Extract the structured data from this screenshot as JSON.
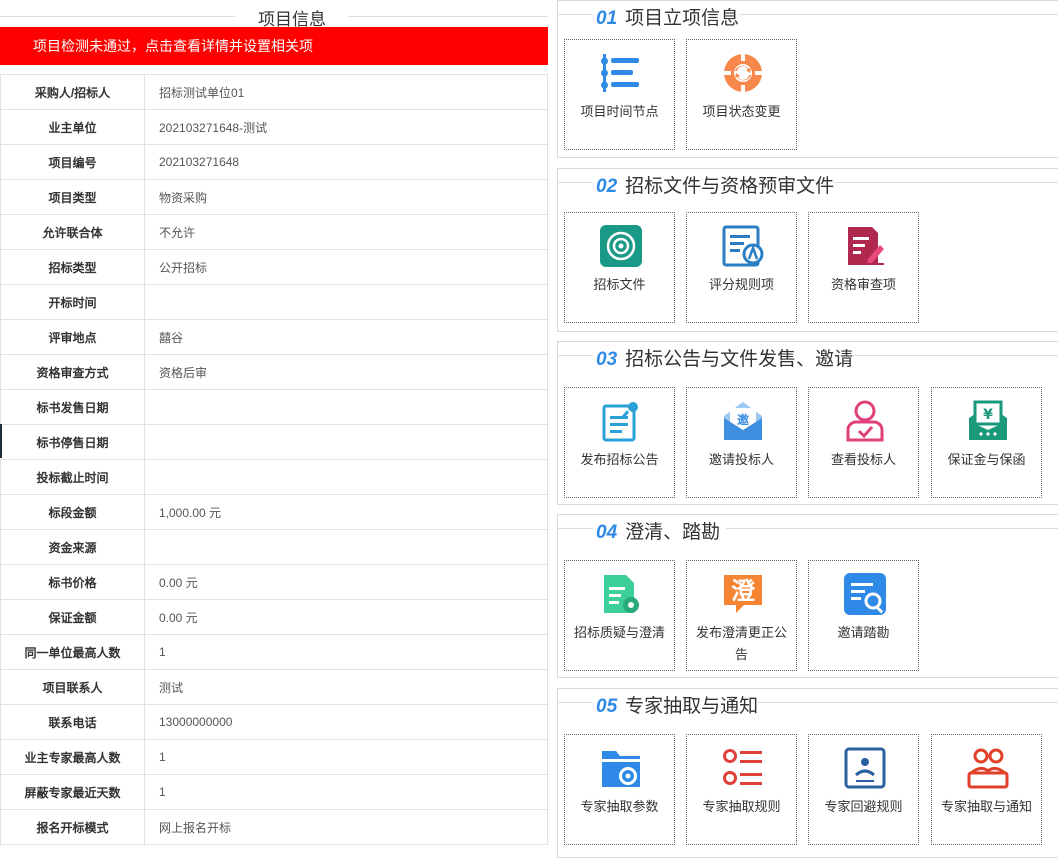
{
  "left": {
    "title": "项目信息",
    "alert": "项目检测未通过，点击查看详情并设置相关项",
    "rows": [
      {
        "label": "采购人/招标人",
        "value": "招标测试单位01"
      },
      {
        "label": "业主单位",
        "value": "202103271648-测试"
      },
      {
        "label": "项目编号",
        "value": "202103271648"
      },
      {
        "label": "项目类型",
        "value": "物资采购"
      },
      {
        "label": "允许联合体",
        "value": "不允许"
      },
      {
        "label": "招标类型",
        "value": "公开招标"
      },
      {
        "label": "开标时间",
        "value": ""
      },
      {
        "label": "评审地点",
        "value": "囍谷"
      },
      {
        "label": "资格审查方式",
        "value": "资格后审"
      },
      {
        "label": "标书发售日期",
        "value": ""
      },
      {
        "label": "标书停售日期",
        "value": ""
      },
      {
        "label": "投标截止时间",
        "value": ""
      },
      {
        "label": "标段金额",
        "value": "1,000.00 元"
      },
      {
        "label": "资金来源",
        "value": ""
      },
      {
        "label": "标书价格",
        "value": "0.00 元"
      },
      {
        "label": "保证金额",
        "value": "0.00 元"
      },
      {
        "label": "同一单位最高人数",
        "value": "1"
      },
      {
        "label": "项目联系人",
        "value": "测试"
      },
      {
        "label": "联系电话",
        "value": "13000000000"
      },
      {
        "label": "业主专家最高人数",
        "value": "1"
      },
      {
        "label": "屏蔽专家最近天数",
        "value": "1"
      },
      {
        "label": "报名开标模式",
        "value": "网上报名开标"
      }
    ]
  },
  "sections": [
    {
      "num": "01",
      "title": "项目立项信息",
      "tiles": [
        {
          "label": "项目时间节点",
          "icon": "timeline-icon",
          "color": "#2e8ae6"
        },
        {
          "label": "项目状态变更",
          "icon": "status-change-icon",
          "color": "#f7874a"
        }
      ]
    },
    {
      "num": "02",
      "title": "招标文件与资格预审文件",
      "tiles": [
        {
          "label": "招标文件",
          "icon": "target-document-icon",
          "color": "#1a9a86"
        },
        {
          "label": "评分规则项",
          "icon": "scoring-rules-icon",
          "color": "#2a7fc4"
        },
        {
          "label": "资格审查项",
          "icon": "qualification-review-icon",
          "color": "#b0284e"
        }
      ]
    },
    {
      "num": "03",
      "title": "招标公告与文件发售、邀请",
      "tiles": [
        {
          "label": "发布招标公告",
          "icon": "publish-notice-icon",
          "color": "#2aa0d8"
        },
        {
          "label": "邀请投标人",
          "icon": "invite-envelope-icon",
          "color": "#3f8fe0"
        },
        {
          "label": "查看投标人",
          "icon": "bidder-view-icon",
          "color": "#e0407a"
        },
        {
          "label": "保证金与保函",
          "icon": "deposit-guarantee-icon",
          "color": "#1a9a7a"
        }
      ]
    },
    {
      "num": "04",
      "title": "澄清、踏勘",
      "tiles": [
        {
          "label": "招标质疑与澄清",
          "icon": "question-clarify-icon",
          "color": "#3ccf9a"
        },
        {
          "label": "发布澄清更正公告",
          "icon": "clarify-notice-icon",
          "color": "#f58533"
        },
        {
          "label": "邀请踏勘",
          "icon": "site-survey-icon",
          "color": "#2e8ae6"
        }
      ]
    },
    {
      "num": "05",
      "title": "专家抽取与通知",
      "tiles": [
        {
          "label": "专家抽取参数",
          "icon": "folder-settings-icon",
          "color": "#2e8ae6"
        },
        {
          "label": "专家抽取规则",
          "icon": "list-rules-icon",
          "color": "#e0403a"
        },
        {
          "label": "专家回避规则",
          "icon": "avoid-rules-icon",
          "color": "#2a5fa0"
        },
        {
          "label": "专家抽取与通知",
          "icon": "expert-notify-icon",
          "color": "#e0402a"
        }
      ]
    }
  ]
}
